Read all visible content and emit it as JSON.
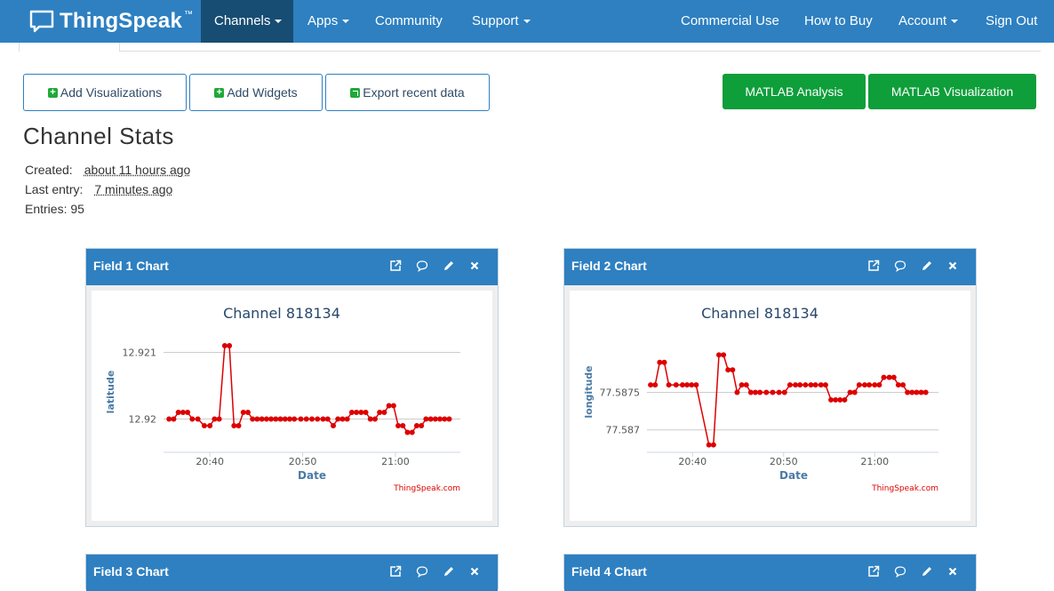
{
  "nav": {
    "brand": "ThingSpeak",
    "brand_tm": "™",
    "items": [
      {
        "label": "Channels",
        "dropdown": true,
        "active": true
      },
      {
        "label": "Apps",
        "dropdown": true
      },
      {
        "label": "Community",
        "dropdown": false
      },
      {
        "label": "Support",
        "dropdown": true
      },
      {
        "label": "Commercial Use",
        "dropdown": false
      },
      {
        "label": "How to Buy",
        "dropdown": false
      },
      {
        "label": "Account",
        "dropdown": true
      },
      {
        "label": "Sign Out",
        "dropdown": false
      }
    ]
  },
  "toolbar": {
    "add_visualizations": "Add Visualizations",
    "add_widgets": "Add Widgets",
    "export_recent": "Export recent data",
    "matlab_analysis": "MATLAB Analysis",
    "matlab_visualization": "MATLAB Visualization"
  },
  "stats": {
    "title": "Channel Stats",
    "created_label": "Created:",
    "created_value": "about 11 hours ago",
    "last_entry_label": "Last entry:",
    "last_entry_value": "7 minutes ago",
    "entries": "Entries: 95"
  },
  "panels": [
    {
      "title": "Field 1 Chart"
    },
    {
      "title": "Field 2 Chart"
    },
    {
      "title": "Field 3 Chart"
    },
    {
      "title": "Field 4 Chart"
    }
  ],
  "colors": {
    "nav_bg": "#2e80c1",
    "nav_active": "#174d73",
    "green": "#0e9e3a",
    "series": "#dd0000"
  },
  "chart_data": [
    {
      "type": "line",
      "title": "Channel 818134",
      "xlabel": "Date",
      "ylabel": "latitude",
      "credit": "ThingSpeak.com",
      "x_ticks": [
        "20:40",
        "20:50",
        "21:00"
      ],
      "x_tick_minutes": [
        40,
        50,
        60
      ],
      "y_ticks": [
        "12.921",
        "12.92"
      ],
      "y_tick_values": [
        12.921,
        12.92
      ],
      "xlim": [
        35,
        67
      ],
      "ylim": [
        12.9195,
        12.9213
      ],
      "series": [
        {
          "values": [
            [
              35.6,
              12.92
            ],
            [
              36.1,
              12.92
            ],
            [
              36.6,
              12.9201
            ],
            [
              37.1,
              12.9201
            ],
            [
              37.6,
              12.9201
            ],
            [
              38.1,
              12.92
            ],
            [
              38.7,
              12.92
            ],
            [
              39.4,
              12.9199
            ],
            [
              40,
              12.9199
            ],
            [
              40.5,
              12.92
            ],
            [
              41,
              12.92
            ],
            [
              41.6,
              12.9211
            ],
            [
              42.1,
              12.9211
            ],
            [
              42.6,
              12.9199
            ],
            [
              43.1,
              12.9199
            ],
            [
              43.6,
              12.9201
            ],
            [
              44.1,
              12.9201
            ],
            [
              44.6,
              12.92
            ],
            [
              45.1,
              12.92
            ],
            [
              45.6,
              12.92
            ],
            [
              46.1,
              12.92
            ],
            [
              46.6,
              12.92
            ],
            [
              47.1,
              12.92
            ],
            [
              47.6,
              12.92
            ],
            [
              48.1,
              12.92
            ],
            [
              48.6,
              12.92
            ],
            [
              49.1,
              12.92
            ],
            [
              49.8,
              12.92
            ],
            [
              50.4,
              12.92
            ],
            [
              51,
              12.92
            ],
            [
              51.6,
              12.92
            ],
            [
              52.2,
              12.92
            ],
            [
              52.7,
              12.92
            ],
            [
              53.3,
              12.9199
            ],
            [
              53.8,
              12.92
            ],
            [
              54.3,
              12.92
            ],
            [
              54.8,
              12.92
            ],
            [
              55.3,
              12.9201
            ],
            [
              55.8,
              12.9201
            ],
            [
              56.3,
              12.9201
            ],
            [
              56.8,
              12.9201
            ],
            [
              57.3,
              12.92
            ],
            [
              57.8,
              12.92
            ],
            [
              58.3,
              12.9201
            ],
            [
              58.8,
              12.9201
            ],
            [
              59.3,
              12.9202
            ],
            [
              59.8,
              12.9202
            ],
            [
              60.3,
              12.9199
            ],
            [
              60.8,
              12.9199
            ],
            [
              61.3,
              12.9198
            ],
            [
              61.8,
              12.9198
            ],
            [
              62.3,
              12.9199
            ],
            [
              62.8,
              12.9199
            ],
            [
              63.3,
              12.92
            ],
            [
              63.8,
              12.92
            ],
            [
              64.3,
              12.92
            ],
            [
              64.8,
              12.92
            ],
            [
              65.3,
              12.92
            ],
            [
              65.8,
              12.92
            ]
          ]
        }
      ]
    },
    {
      "type": "line",
      "title": "Channel 818134",
      "xlabel": "Date",
      "ylabel": "longitude",
      "credit": "ThingSpeak.com",
      "x_ticks": [
        "20:40",
        "20:50",
        "21:00"
      ],
      "x_tick_minutes": [
        40,
        50,
        60
      ],
      "y_ticks": [
        "77.5875",
        "77.587"
      ],
      "y_tick_values": [
        77.5875,
        77.587
      ],
      "xlim": [
        35,
        67
      ],
      "ylim": [
        77.5867,
        77.5883
      ],
      "series": [
        {
          "values": [
            [
              35.4,
              77.5876
            ],
            [
              35.9,
              77.5876
            ],
            [
              36.4,
              77.5879
            ],
            [
              36.9,
              77.5879
            ],
            [
              37.4,
              77.5876
            ],
            [
              38.2,
              77.5876
            ],
            [
              38.9,
              77.5876
            ],
            [
              39.4,
              77.5876
            ],
            [
              39.9,
              77.5876
            ],
            [
              40.4,
              77.5876
            ],
            [
              41.8,
              77.5868
            ],
            [
              42.3,
              77.5868
            ],
            [
              42.9,
              77.588
            ],
            [
              43.4,
              77.588
            ],
            [
              43.9,
              77.5878
            ],
            [
              44.4,
              77.5878
            ],
            [
              44.9,
              77.5875
            ],
            [
              45.4,
              77.5876
            ],
            [
              45.9,
              77.5876
            ],
            [
              46.4,
              77.5875
            ],
            [
              46.9,
              77.5875
            ],
            [
              47.4,
              77.5875
            ],
            [
              48.1,
              77.5875
            ],
            [
              48.8,
              77.5875
            ],
            [
              49.5,
              77.5875
            ],
            [
              50.1,
              77.5875
            ],
            [
              50.7,
              77.5876
            ],
            [
              51.3,
              77.5876
            ],
            [
              51.8,
              77.5876
            ],
            [
              52.4,
              77.5876
            ],
            [
              53,
              77.5876
            ],
            [
              53.5,
              77.5876
            ],
            [
              54.1,
              77.5876
            ],
            [
              54.6,
              77.5876
            ],
            [
              55.2,
              77.5874
            ],
            [
              55.7,
              77.5874
            ],
            [
              56.2,
              77.5874
            ],
            [
              56.7,
              77.5874
            ],
            [
              57.3,
              77.5875
            ],
            [
              57.8,
              77.5875
            ],
            [
              58.3,
              77.5876
            ],
            [
              58.9,
              77.5876
            ],
            [
              59.4,
              77.5876
            ],
            [
              60,
              77.5876
            ],
            [
              60.5,
              77.5876
            ],
            [
              61,
              77.5877
            ],
            [
              61.6,
              77.5877
            ],
            [
              62.1,
              77.5877
            ],
            [
              62.6,
              77.5876
            ],
            [
              63.1,
              77.5876
            ],
            [
              63.6,
              77.5875
            ],
            [
              64.1,
              77.5875
            ],
            [
              64.6,
              77.5875
            ],
            [
              65.1,
              77.5875
            ],
            [
              65.6,
              77.5875
            ]
          ]
        }
      ]
    }
  ]
}
